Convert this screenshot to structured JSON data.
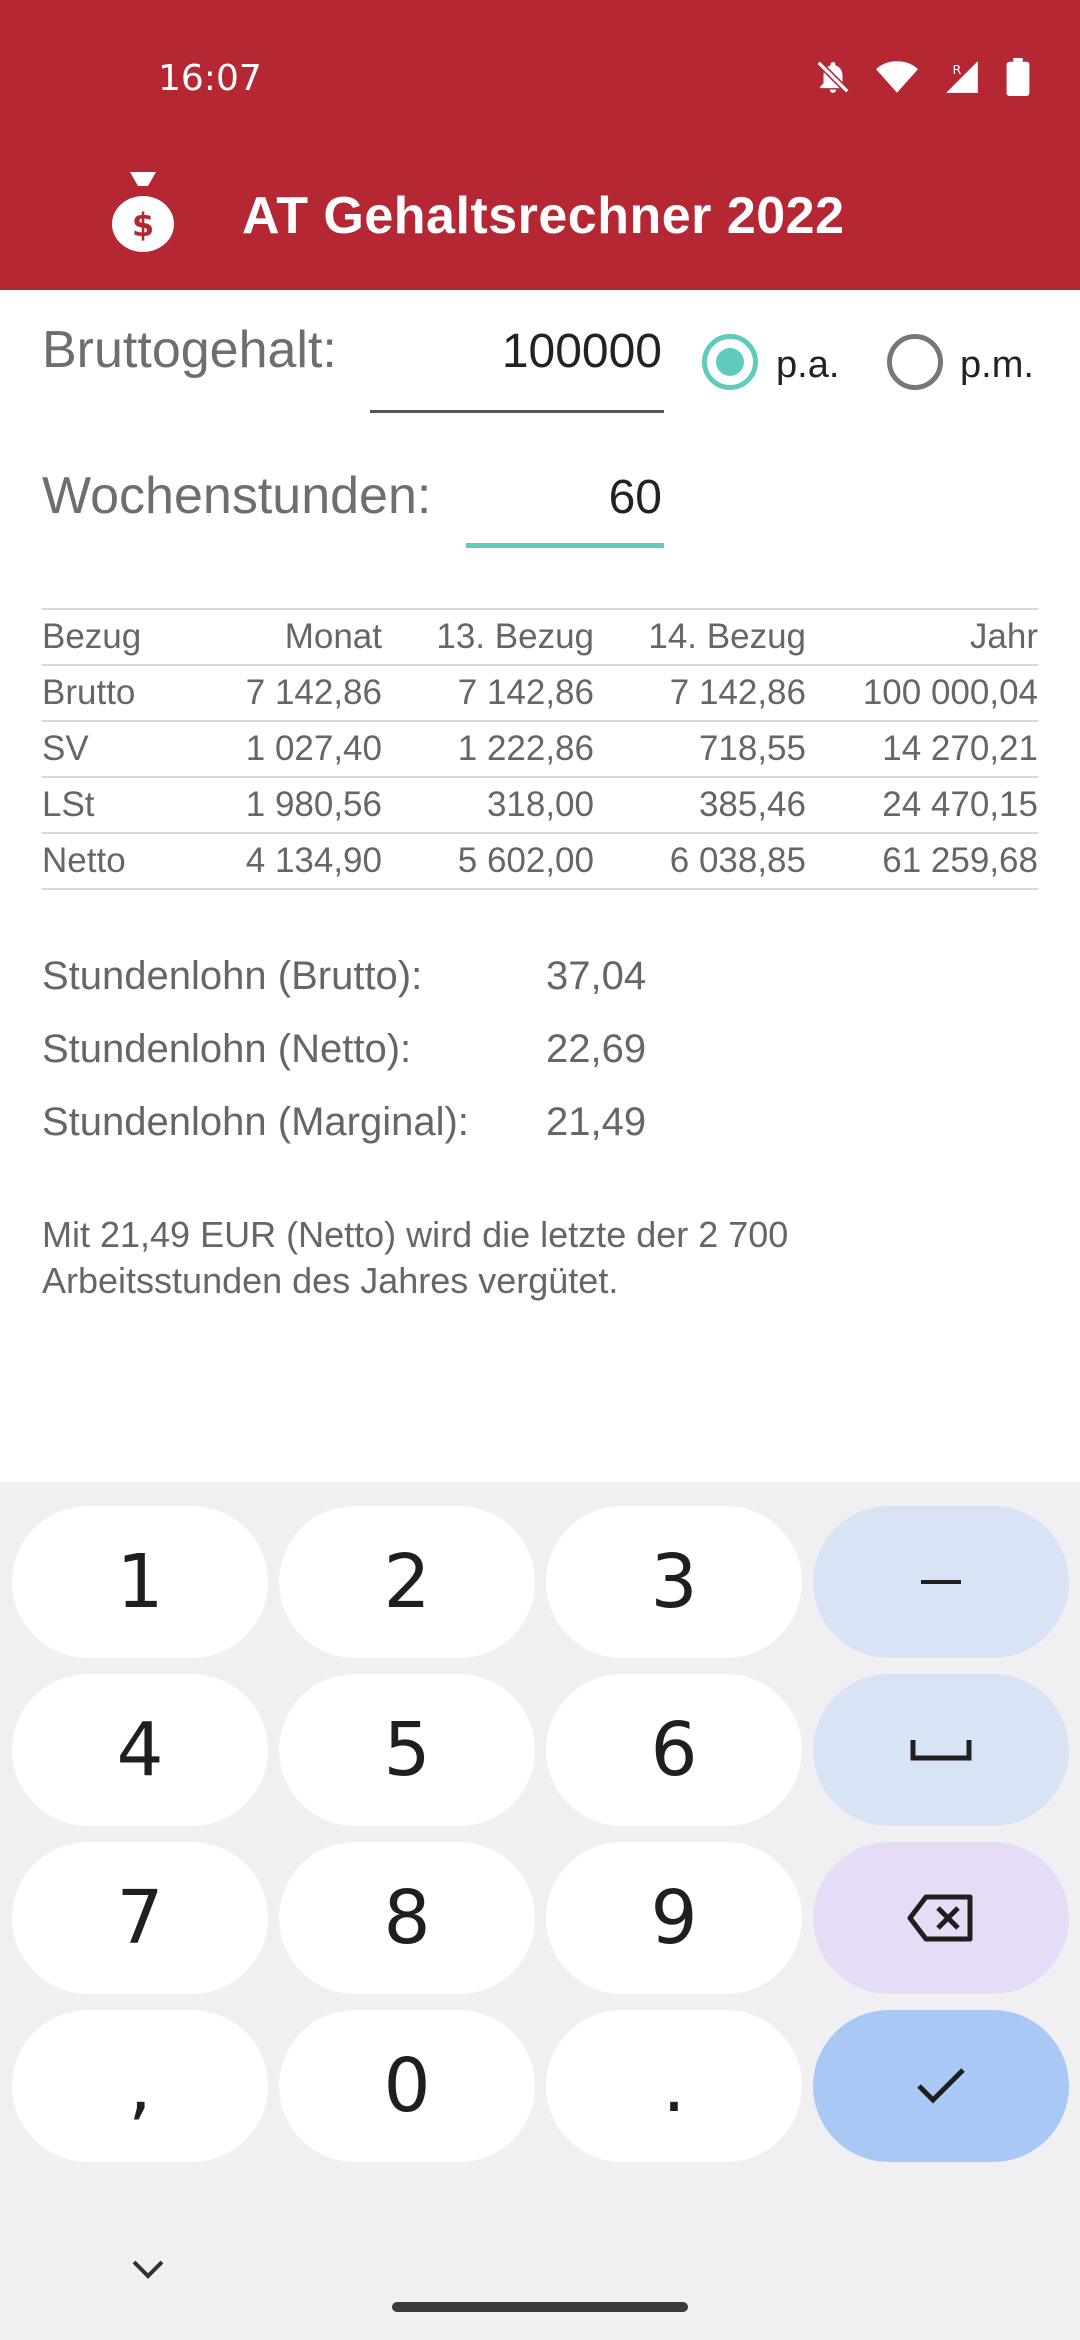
{
  "status": {
    "time": "16:07"
  },
  "app": {
    "title": "AT Gehaltsrechner 2022"
  },
  "form": {
    "gross_label": "Bruttogehalt:",
    "gross_value": "100000",
    "period_pa": "p.a.",
    "period_pm": "p.m.",
    "period_selected": "p.a.",
    "hours_label": "Wochenstunden:",
    "hours_value": "60"
  },
  "table": {
    "headers": [
      "Bezug",
      "Monat",
      "13. Bezug",
      "14. Bezug",
      "Jahr"
    ],
    "rows": [
      [
        "Brutto",
        "7 142,86",
        "7 142,86",
        "7 142,86",
        "100 000,04"
      ],
      [
        "SV",
        "1 027,40",
        "1 222,86",
        "718,55",
        "14 270,21"
      ],
      [
        "LSt",
        "1 980,56",
        "318,00",
        "385,46",
        "24 470,15"
      ],
      [
        "Netto",
        "4 134,90",
        "5 602,00",
        "6 038,85",
        "61 259,68"
      ]
    ]
  },
  "hourly": [
    {
      "label": "Stundenlohn (Brutto):",
      "value": "37,04"
    },
    {
      "label": "Stundenlohn (Netto):",
      "value": "22,69"
    },
    {
      "label": "Stundenlohn (Marginal):",
      "value": "21,49"
    }
  ],
  "note": "Mit 21,49 EUR (Netto) wird die letzte der 2 700 Arbeitsstunden des Jahres vergütet.",
  "keyboard": {
    "keys": [
      "1",
      "2",
      "3",
      "–",
      "4",
      "5",
      "6",
      "␣",
      "7",
      "8",
      "9",
      "⌫",
      ",",
      "0",
      ".",
      "✓"
    ]
  },
  "colors": {
    "accent": "#b52833",
    "focus": "#5ecbbd"
  }
}
